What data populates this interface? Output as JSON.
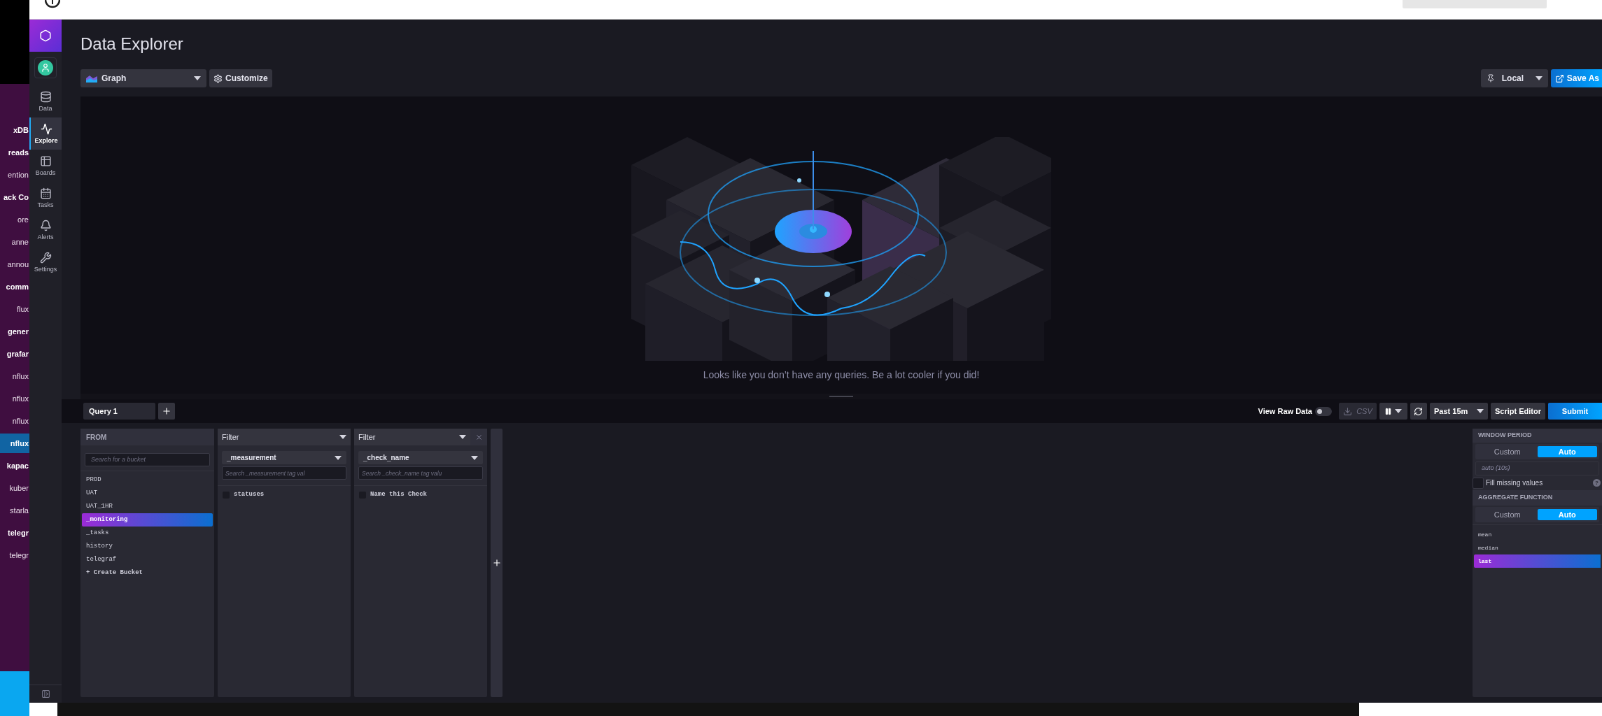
{
  "background_window": {
    "channels": [
      {
        "text": "xDB",
        "bold": true,
        "selected": false
      },
      {
        "text": "reads",
        "bold": true,
        "selected": false
      },
      {
        "text": "ention",
        "bold": false,
        "selected": false
      },
      {
        "text": "ack Co",
        "bold": true,
        "selected": false
      },
      {
        "text": "ore",
        "bold": false,
        "selected": false
      },
      {
        "text": "anne",
        "bold": false,
        "selected": false
      },
      {
        "text": "annou",
        "bold": false,
        "selected": false
      },
      {
        "text": "comm",
        "bold": true,
        "selected": false
      },
      {
        "text": "flux",
        "bold": false,
        "selected": false
      },
      {
        "text": "gener",
        "bold": true,
        "selected": false
      },
      {
        "text": "grafar",
        "bold": true,
        "selected": false
      },
      {
        "text": "nflux",
        "bold": false,
        "selected": false
      },
      {
        "text": "nflux",
        "bold": false,
        "selected": false
      },
      {
        "text": "nflux",
        "bold": false,
        "selected": false
      },
      {
        "text": "nflux",
        "bold": true,
        "selected": true
      },
      {
        "text": "kapac",
        "bold": true,
        "selected": false
      },
      {
        "text": "kuber",
        "bold": false,
        "selected": false
      },
      {
        "text": "starla",
        "bold": false,
        "selected": false
      },
      {
        "text": "telegr",
        "bold": true,
        "selected": false
      },
      {
        "text": "telegr",
        "bold": false,
        "selected": false
      }
    ]
  },
  "nav": [
    {
      "label": "Data",
      "kind": "database",
      "selected": false
    },
    {
      "label": "Explore",
      "kind": "pulse",
      "selected": true
    },
    {
      "label": "Boards",
      "kind": "grid",
      "selected": false
    },
    {
      "label": "Tasks",
      "kind": "calendar",
      "selected": false
    },
    {
      "label": "Alerts",
      "kind": "bell",
      "selected": false
    },
    {
      "label": "Settings",
      "kind": "wrench",
      "selected": false
    }
  ],
  "header": {
    "title": "Data Explorer",
    "view_type": "Graph",
    "customize": "Customize",
    "timezone": "Local",
    "save": "Save As"
  },
  "empty_state": {
    "message": "Looks like you don’t have any queries. Be a lot cooler if you did!"
  },
  "query_tabs": [
    {
      "label": "Query 1",
      "selected": true
    }
  ],
  "toolbar": {
    "view_raw_data": {
      "label": "View Raw Data",
      "on": false
    },
    "csv": {
      "label": "CSV",
      "disabled": true
    },
    "time_range": "Past 15m",
    "script_editor": "Script Editor",
    "submit": "Submit"
  },
  "from": {
    "title": "FROM",
    "placeholder": "Search for a bucket",
    "buckets": [
      {
        "name": "PROD",
        "selected": false
      },
      {
        "name": "UAT",
        "selected": false
      },
      {
        "name": "UAT_1HR",
        "selected": false
      },
      {
        "name": "_monitoring",
        "selected": true
      },
      {
        "name": "_tasks",
        "selected": false
      },
      {
        "name": "history",
        "selected": false
      },
      {
        "name": "telegraf",
        "selected": false
      }
    ],
    "create": "+ Create Bucket"
  },
  "filters": [
    {
      "title": "Filter",
      "key": "_measurement",
      "placeholder": "Search _measurement tag val",
      "closable": false,
      "values": [
        {
          "name": "statuses",
          "checked": false
        }
      ]
    },
    {
      "title": "Filter",
      "key": "_check_name",
      "placeholder": "Search _check_name tag valu",
      "closable": true,
      "values": [
        {
          "name": "Name this Check",
          "checked": false
        }
      ]
    }
  ],
  "window_period": {
    "title": "WINDOW PERIOD",
    "options": [
      {
        "label": "Custom",
        "selected": false
      },
      {
        "label": "Auto",
        "selected": true
      }
    ],
    "value": "auto (10s)",
    "fill_missing": {
      "label": "Fill missing values",
      "checked": false
    },
    "help": "?"
  },
  "aggregate": {
    "title": "AGGREGATE FUNCTION",
    "options": [
      {
        "label": "Custom",
        "selected": false
      },
      {
        "label": "Auto",
        "selected": true
      }
    ],
    "functions": [
      {
        "name": "mean",
        "selected": false
      },
      {
        "name": "median",
        "selected": false
      },
      {
        "name": "last",
        "selected": true
      }
    ]
  }
}
